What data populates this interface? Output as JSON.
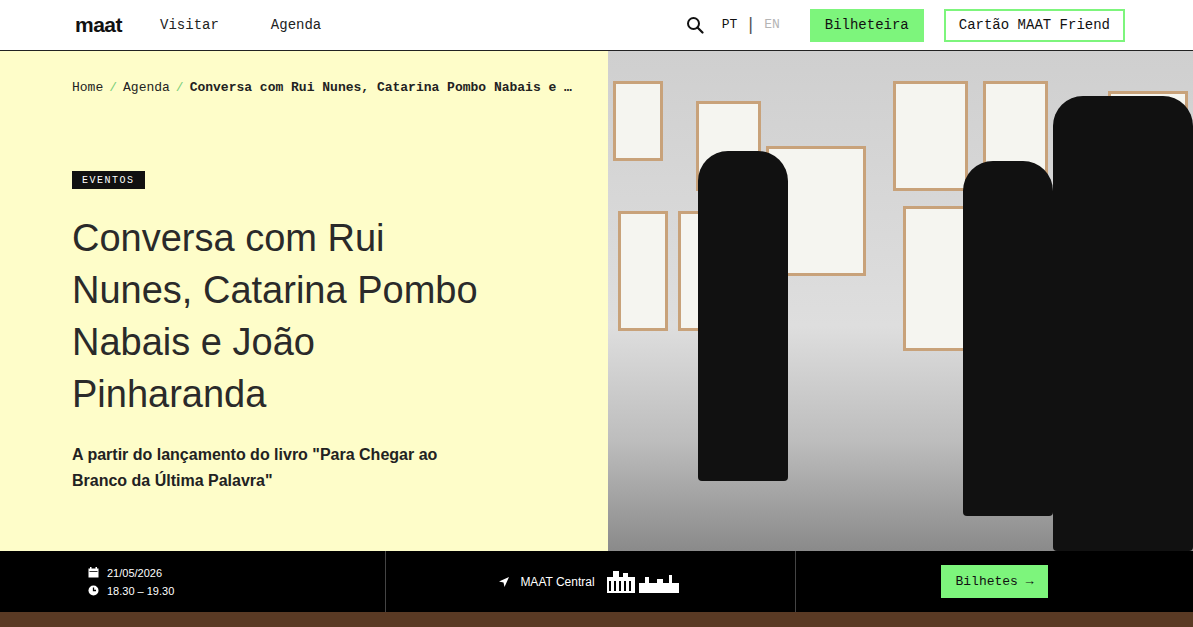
{
  "nav": {
    "logo": "maat",
    "links": [
      "Visitar",
      "Agenda"
    ],
    "language_separator": "|",
    "languages": [
      {
        "label": "PT",
        "selected": true
      },
      {
        "label": "EN",
        "selected": false
      }
    ],
    "buttons": [
      "Bilheteira",
      "Cartão MAAT Friend"
    ]
  },
  "breadcrumb": {
    "separator": "/",
    "items": [
      {
        "label": "Home",
        "current": false
      },
      {
        "label": "Agenda",
        "current": false
      },
      {
        "label": "Conversa com Rui Nunes, Catarina Pombo Nabais e …",
        "current": true
      }
    ]
  },
  "event": {
    "category": "EVENTOS",
    "title": "Conversa com Rui Nunes, Catarina Pombo Nabais e João Pinharanda",
    "subtitle": "A partir do lançamento do livro \"Para Chegar ao Branco da Última Palavra\""
  },
  "info": {
    "date": "21/05/2026",
    "time": "18.30 – 19.30",
    "location": "MAAT Central",
    "button": "Bilhetes →"
  }
}
